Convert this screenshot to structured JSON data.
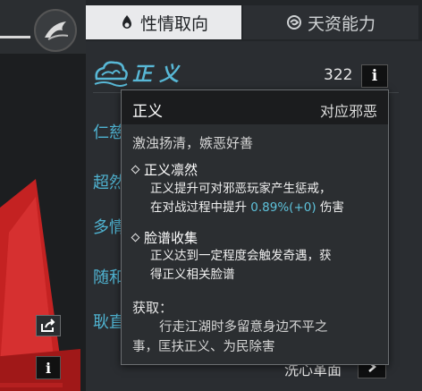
{
  "tabs": {
    "active_label": "性情取向",
    "inactive_label": "天资能力"
  },
  "header": {
    "title": "正义",
    "score": "322"
  },
  "list_items": [
    "仁慈",
    "超然",
    "多情",
    "随和",
    "耿直"
  ],
  "tooltip": {
    "title": "正义",
    "subtitle": "对应邪恶",
    "motto": "激浊扬清，嫉恶好善",
    "section1": {
      "title": "正义凛然",
      "line1": "正义提升可对邪恶玩家产生惩戒，",
      "line2_prefix": "在对战过程中提升 ",
      "line2_value": "0.89%(+0)",
      "line2_suffix": " 伤害"
    },
    "section2": {
      "title": "脸谱收集",
      "line1": "正义达到一定程度会触发奇遇，获",
      "line2": "得正义相关脸谱"
    },
    "obtain_label": "获取：",
    "obtain_line1": "行走江湖时多留意身边不平之",
    "obtain_line2": "事，匡扶正义、为民除害"
  },
  "footer": {
    "link_label": "洗心革面"
  },
  "colors": {
    "accent": "#4fb3d1",
    "highlight": "#5ec3dc",
    "tab_active_bg": "#e9eaec",
    "panel_bg": "#2a2d31",
    "figure_red": "#b52020"
  },
  "icons": {
    "tab_active": "flame-icon",
    "tab_inactive": "swirl-icon",
    "header": "cloud-emblem-icon",
    "info": "info-icon",
    "share": "share-icon",
    "next": "chevron-right-icon"
  }
}
